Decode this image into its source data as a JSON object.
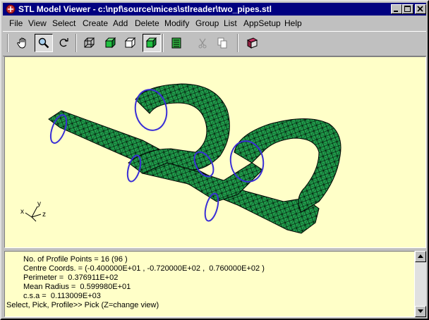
{
  "window": {
    "title": "STL Model Viewer - c:\\npf\\source\\mices\\stlreader\\two_pipes.stl",
    "controls": [
      "minimize",
      "maximize",
      "close"
    ]
  },
  "menu": [
    "File",
    "View",
    "Select",
    "Create",
    "Add",
    "Delete",
    "Modify",
    "Group",
    "List",
    "AppSetup",
    "Help"
  ],
  "toolbar": {
    "buttons": [
      {
        "icon": "hand-pan-icon",
        "pressed": false
      },
      {
        "icon": "zoom-magnifier-icon",
        "pressed": true
      },
      {
        "icon": "rotate-icon",
        "pressed": false
      },
      {
        "icon": "wireframe-box-icon",
        "pressed": false
      },
      {
        "icon": "shaded-box-icon",
        "pressed": false
      },
      {
        "icon": "hidden-line-box-icon",
        "pressed": false
      },
      {
        "icon": "shaded-box-pressed-icon",
        "pressed": true
      },
      {
        "icon": "list-table-icon",
        "pressed": false
      },
      {
        "icon": "cut-icon",
        "pressed": false
      },
      {
        "icon": "copy-icon",
        "pressed": false
      },
      {
        "icon": "book-icon",
        "pressed": false
      }
    ]
  },
  "viewport": {
    "background": "#ffffc8",
    "mesh_fill": "#1f9b4a",
    "mesh_stroke": "#000000",
    "profile_color": "#3a2fd6",
    "axis_labels": {
      "x": "x",
      "y": "y",
      "z": "z"
    }
  },
  "output": {
    "lines": [
      "No. of Profile Points = 16 (96 )",
      "Centre Coords. = (-0.400000E+01 , -0.720000E+02 ,  0.760000E+02 )",
      "Perimeter =  0.376911E+02",
      "Mean Radius =  0.599980E+01",
      "c.s.a =  0.113009E+03",
      "Select, Pick, Profile>> Pick (Z=change view)"
    ]
  }
}
